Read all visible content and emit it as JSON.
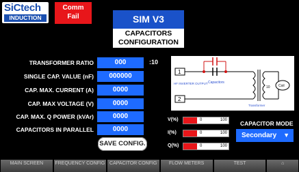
{
  "logo": {
    "line1": "SiCtech",
    "line2": "INDUCTION"
  },
  "comm_status": {
    "line1": "Comm",
    "line2": "Fail"
  },
  "header": {
    "title": "SIM V3",
    "subtitle_line1": "CAPACITORS",
    "subtitle_line2": "CONFIGURATION"
  },
  "fields": [
    {
      "label": "TRANSFORMER RATIO",
      "value": "000"
    },
    {
      "label": "SINGLE CAP. VALUE (nF)",
      "value": "000000"
    },
    {
      "label": "CAP. MAX. CURRENT (A)",
      "value": "0000"
    },
    {
      "label": "CAP. MAX VOLTAGE (V)",
      "value": "0000"
    },
    {
      "label": "CAP. MAX. Q POWER (kVAr)",
      "value": "0000"
    },
    {
      "label": "CAPACITORS IN PARALLEL",
      "value": "0000"
    }
  ],
  "ratio_unit": ":10",
  "save_label": "SAVE CONFIG.",
  "diagram": {
    "port1": "1",
    "port2": "2",
    "inverter": "HF INVERTER OUTPUT",
    "capacitors": "Capacitors",
    "transformer": "Transformer",
    "ratio": "10",
    "coil": "Coil"
  },
  "meters": [
    {
      "label": "V(%)",
      "zero": "0",
      "full": "100",
      "level": 0
    },
    {
      "label": "I(%)",
      "zero": "0",
      "full": "100",
      "level": 0
    },
    {
      "label": "Q(%)",
      "zero": "0",
      "full": "100",
      "level": 0
    }
  ],
  "capacitor_mode": {
    "label": "CAPACITOR MODE",
    "selected": "Secondary"
  },
  "nav": [
    {
      "label": "MAIN SCREEN"
    },
    {
      "label": "FREQUENCY CONFIG"
    },
    {
      "label": "CAPACITOR CONFIG"
    },
    {
      "label": "FLOW METERS"
    },
    {
      "label": "TEST"
    },
    {
      "label": ""
    }
  ],
  "colors": {
    "accent": "#1e6bff",
    "alarm": "#e8161a",
    "header": "#1a52c9"
  }
}
